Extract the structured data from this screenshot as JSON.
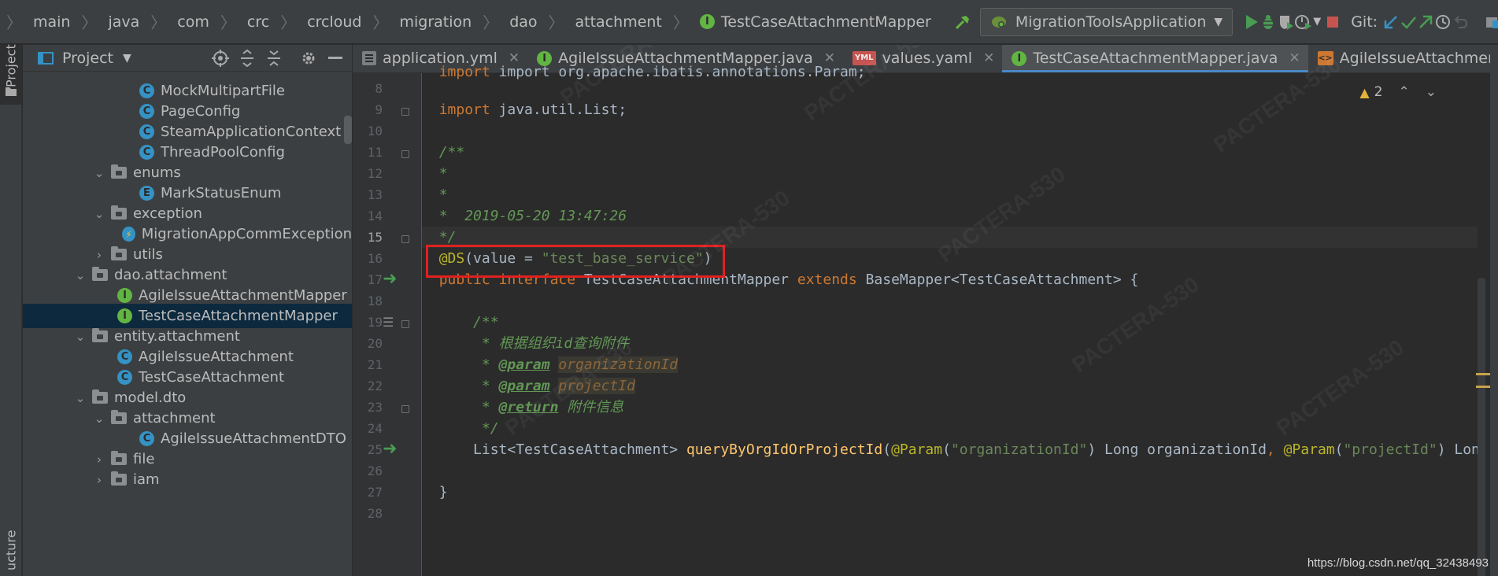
{
  "breadcrumbs": [
    "main",
    "java",
    "com",
    "crc",
    "crcloud",
    "migration",
    "dao",
    "attachment"
  ],
  "breadcrumb_file": "TestCaseAttachmentMapper",
  "run_config": "MigrationToolsApplication",
  "git_label": "Git:",
  "project_panel": {
    "title": "Project",
    "tree": [
      {
        "label": "MockMultipartFile",
        "kind": "class"
      },
      {
        "label": "PageConfig",
        "kind": "class"
      },
      {
        "label": "SteamApplicationContext",
        "kind": "class"
      },
      {
        "label": "ThreadPoolConfig",
        "kind": "class"
      },
      {
        "label": "enums",
        "kind": "folder",
        "state": "expanded"
      },
      {
        "label": "MarkStatusEnum",
        "kind": "enum"
      },
      {
        "label": "exception",
        "kind": "folder",
        "state": "expanded"
      },
      {
        "label": "MigrationAppCommException",
        "kind": "exception"
      },
      {
        "label": "utils",
        "kind": "folder",
        "state": "collapsed"
      },
      {
        "label": "dao.attachment",
        "kind": "folder",
        "state": "expanded"
      },
      {
        "label": "AgileIssueAttachmentMapper",
        "kind": "interface"
      },
      {
        "label": "TestCaseAttachmentMapper",
        "kind": "interface",
        "selected": true
      },
      {
        "label": "entity.attachment",
        "kind": "folder",
        "state": "expanded"
      },
      {
        "label": "AgileIssueAttachment",
        "kind": "class"
      },
      {
        "label": "TestCaseAttachment",
        "kind": "class"
      },
      {
        "label": "model.dto",
        "kind": "folder",
        "state": "expanded"
      },
      {
        "label": "attachment",
        "kind": "folder",
        "state": "expanded"
      },
      {
        "label": "AgileIssueAttachmentDTO",
        "kind": "class"
      },
      {
        "label": "file",
        "kind": "folder",
        "state": "collapsed"
      },
      {
        "label": "iam",
        "kind": "folder",
        "state": "collapsed"
      }
    ]
  },
  "left_strip": {
    "project_tab": "Project",
    "structure_tab": "ucture"
  },
  "tabs": [
    {
      "label": "application.yml",
      "icon": "yml-file-icon"
    },
    {
      "label": "AgileIssueAttachmentMapper.java",
      "icon": "interface-icon"
    },
    {
      "label": "values.yaml",
      "icon": "yaml-file-icon"
    },
    {
      "label": "TestCaseAttachmentMapper.java",
      "icon": "interface-icon",
      "active": true
    },
    {
      "label": "AgileIssueAttachmentMapper.xml",
      "icon": "xml-file-icon"
    }
  ],
  "editor": {
    "warning_count": "2",
    "current_line": 15,
    "line_numbers": [
      "8",
      "9",
      "10",
      "11",
      "12",
      "13",
      "14",
      "15",
      "16",
      "17",
      "18",
      "19",
      "20",
      "21",
      "22",
      "23",
      "24",
      "25",
      "26",
      "27",
      "28"
    ],
    "top_partial_line": "import org.apache.ibatis.annotations.Param;",
    "code": {
      "l9": "java.util.List;",
      "l12": "*",
      "l13": "*",
      "l14": "*  2019-05-20 13:47:26",
      "l16_ann": "@DS",
      "l16_open": "(value = ",
      "l16_str": "\"test_base_service\"",
      "l16_close": ")",
      "l17_type": "TestCaseAttachmentMapper ",
      "l17_base": "BaseMapper<TestCaseAttachment> {",
      "l20": "* 根据组织id查询附件",
      "l21_param": "organizationId",
      "l22_param": "projectId",
      "l23_text": " 附件信息",
      "l25_type": "List<TestCaseAttachment> ",
      "l25_method": "queryByOrgIdOrProjectId",
      "l25_a1_str": "\"organizationId\"",
      "l25_a1_var": ") Long organizationId",
      "l25_a2_str": "\"projectId\"",
      "l25_a2_var": ") Long",
      "l27": "}"
    }
  },
  "footer_watermark": "https://blog.csdn.net/qq_32438493",
  "bg_watermark": "PACTERA-530",
  "colors": {
    "accent": "#4a88c7",
    "highlight_box": "#e02020",
    "keyword": "#cc7832",
    "annotation": "#bbb529",
    "string": "#6a8759"
  }
}
